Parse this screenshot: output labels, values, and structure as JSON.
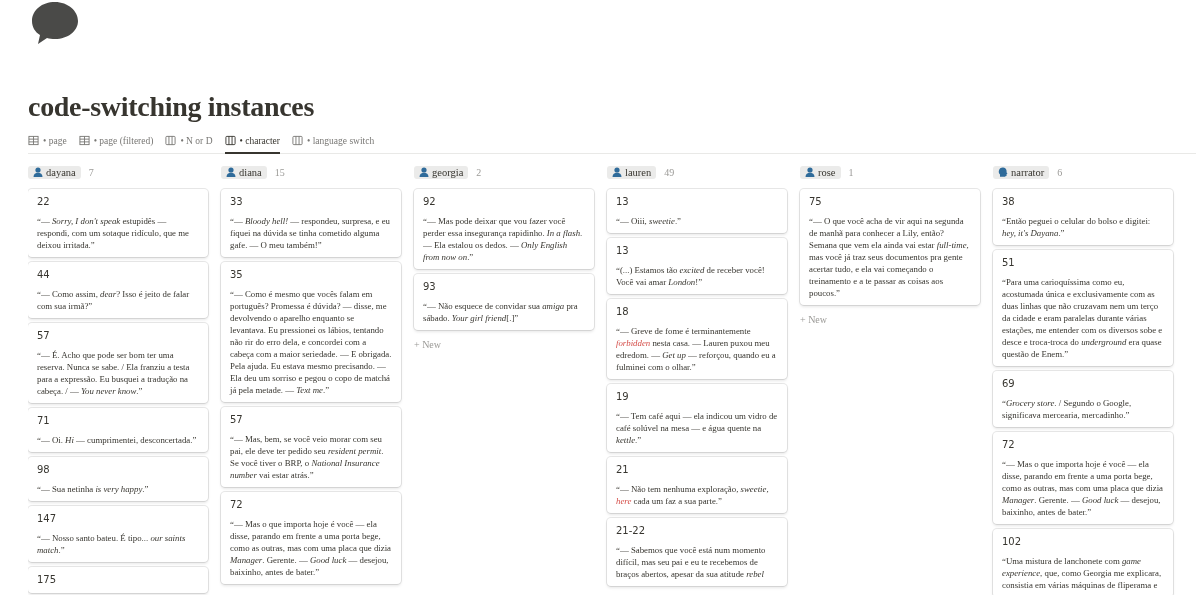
{
  "page": {
    "title": "code-switching instances"
  },
  "views": [
    {
      "label": "• page",
      "kind": "table",
      "selected": false
    },
    {
      "label": "• page (filtered)",
      "kind": "table",
      "selected": false
    },
    {
      "label": "• N or D",
      "kind": "board",
      "selected": false
    },
    {
      "label": "• character",
      "kind": "board",
      "selected": true
    },
    {
      "label": "• language switch",
      "kind": "board",
      "selected": false
    }
  ],
  "columns": [
    {
      "name": "dayana",
      "kind": "person",
      "count": "7",
      "cards": [
        {
          "number": "22",
          "text": [
            {
              "t": "“— *Sorry, I don't speak* estupidês — respondi, com um sotaque ridículo, que me deixou irritada.”"
            }
          ]
        },
        {
          "number": "44",
          "text": [
            {
              "t": "“— Como assim, *dear*? Isso é jeito de falar com sua irmã?”"
            }
          ]
        },
        {
          "number": "57",
          "text": [
            {
              "t": "“— É. Acho que pode ser bom ter uma reserva. Nunca se sabe. / Ela franziu a testa para a expressão. Eu busquei a tradução na cabeça. / — *You never know*.”"
            }
          ]
        },
        {
          "number": "71",
          "text": [
            {
              "t": "“— Oi. *Hi* — cumprimentei, desconcertada.”"
            }
          ]
        },
        {
          "number": "98",
          "text": [
            {
              "t": "“— Sua netinha *is very happy*.”"
            }
          ]
        },
        {
          "number": "147",
          "text": [
            {
              "t": "“— Nosso santo bateu. É tipo... *our saints match*.”"
            }
          ]
        },
        {
          "number": "175"
        }
      ]
    },
    {
      "name": "diana",
      "kind": "person",
      "count": "15",
      "cards": [
        {
          "number": "33",
          "text": [
            {
              "t": "“— *Bloody hell!* — respondeu, surpresa, e eu fiquei na dúvida se tinha cometido alguma gafe. — O meu também!”"
            }
          ]
        },
        {
          "number": "35",
          "text": [
            {
              "t": "“— Como é mesmo que vocês falam em português? Promessa é dúvida? — disse, me devolvendo o aparelho enquanto se levantava. Eu pressionei os lábios, tentando não rir do erro dela, e concordei com a cabeça com a maior seriedade. — E obrigada. Pela ajuda. Eu estava mesmo precisando. — Ela deu um sorriso e pegou o copo de matchá já pela metade. — *Text me*.”"
            }
          ]
        },
        {
          "number": "57",
          "text": [
            {
              "t": "“— Mas, bem, se você veio morar com seu pai, ele deve ter pedido seu *resident permit*. Se você tiver o BRP, o *National Insurance number* vai estar atrás.”"
            }
          ]
        },
        {
          "number": "72",
          "text": [
            {
              "t": "“— Mas o que importa hoje é você — ela disse, parando em frente a uma porta bege, como as outras, mas com uma placa que dizia *Manager*. Gerente. — *Good luck* — desejou, baixinho, antes de bater.”"
            }
          ]
        }
      ]
    },
    {
      "name": "georgia",
      "kind": "person",
      "count": "2",
      "new_label": "+ New",
      "cards": [
        {
          "number": "92",
          "text": [
            {
              "t": "“— Mas pode deixar que vou fazer você perder essa insegurança rapidinho. *In a flash*. — Ela estalou os dedos. — *Only English from now on*.”"
            }
          ]
        },
        {
          "number": "93",
          "text": [
            {
              "t": "“— Não esquece de convidar sua *amiga* pra sábado. *Your girl friend*[.]”"
            }
          ]
        }
      ]
    },
    {
      "name": "lauren",
      "kind": "person",
      "count": "49",
      "cards": [
        {
          "number": "13",
          "text": [
            {
              "t": "“— Oiii, *sweetie*.”"
            }
          ]
        },
        {
          "number": "13",
          "text": [
            {
              "t": "“(...) Estamos tão *excited* de receber você! Você vai amar *London*!”"
            }
          ]
        },
        {
          "number": "18",
          "text": [
            {
              "t": "“— Greve de fome é terminantemente "
            },
            {
              "t": "*forbidden*",
              "kind": "highlight"
            },
            {
              "t": " nesta casa. — Lauren puxou meu edredom. — *Get up* — reforçou, quando eu a fulminei com o olhar.”"
            }
          ]
        },
        {
          "number": "19",
          "text": [
            {
              "t": "“— Tem café aqui — ela indicou um vidro de café solúvel na mesa — e água quente na *kettle*.”"
            }
          ]
        },
        {
          "number": "21",
          "text": [
            {
              "t": "“— Não tem nenhuma exploração, *sweetie*, "
            },
            {
              "t": "*here*",
              "kind": "highlight"
            },
            {
              "t": " cada um faz a sua parte.”"
            }
          ]
        },
        {
          "number": "21-22",
          "text": [
            {
              "t": "“— Sabemos que você está num momento difícil, mas seu pai e eu te recebemos de braços abertos, apesar da sua atitude *rebel*"
            }
          ]
        }
      ]
    },
    {
      "name": "rose",
      "kind": "person",
      "count": "1",
      "new_label": "+ New",
      "cards": [
        {
          "number": "75",
          "text": [
            {
              "t": "“— O que você acha de vir aqui na segunda de manhã para conhecer a Lily, então? Semana que vem ela ainda vai estar *full-time*, mas você já traz seus documentos pra gente acertar tudo, e ela vai começando o treinamento e a te passar as coisas aos poucos.”"
            }
          ]
        }
      ]
    },
    {
      "name": "narrator",
      "kind": "speaker",
      "count": "6",
      "cards": [
        {
          "number": "38",
          "text": [
            {
              "t": "“Então peguei o celular do bolso e digitei: *hey, it's Dayana*.”"
            }
          ]
        },
        {
          "number": "51",
          "text": [
            {
              "t": "“Para uma carioquíssima como eu, acostumada única e exclusivamente com as duas linhas que não cruzavam nem um terço da cidade e eram paralelas durante várias estações, me entender com os diversos sobe e desce e troca-troca do *underground* era quase questão de Enem.”"
            }
          ]
        },
        {
          "number": "69",
          "text": [
            {
              "t": "“*Grocery store*. / Segundo o Google, significava mercearia, mercadinho.”"
            }
          ]
        },
        {
          "number": "72",
          "text": [
            {
              "t": "“— Mas o que importa hoje é você — ela disse, parando em frente a uma porta bege, como as outras, mas com uma placa que dizia *Manager*. Gerente. — *Good luck* — desejou, baixinho, antes de bater.”"
            }
          ]
        },
        {
          "number": "102",
          "text": [
            {
              "t": "“Uma mistura de lanchonete com *game experience*, que, como Georgia me explicara, consistia em várias máquinas de fliperama e"
            }
          ]
        }
      ]
    }
  ]
}
